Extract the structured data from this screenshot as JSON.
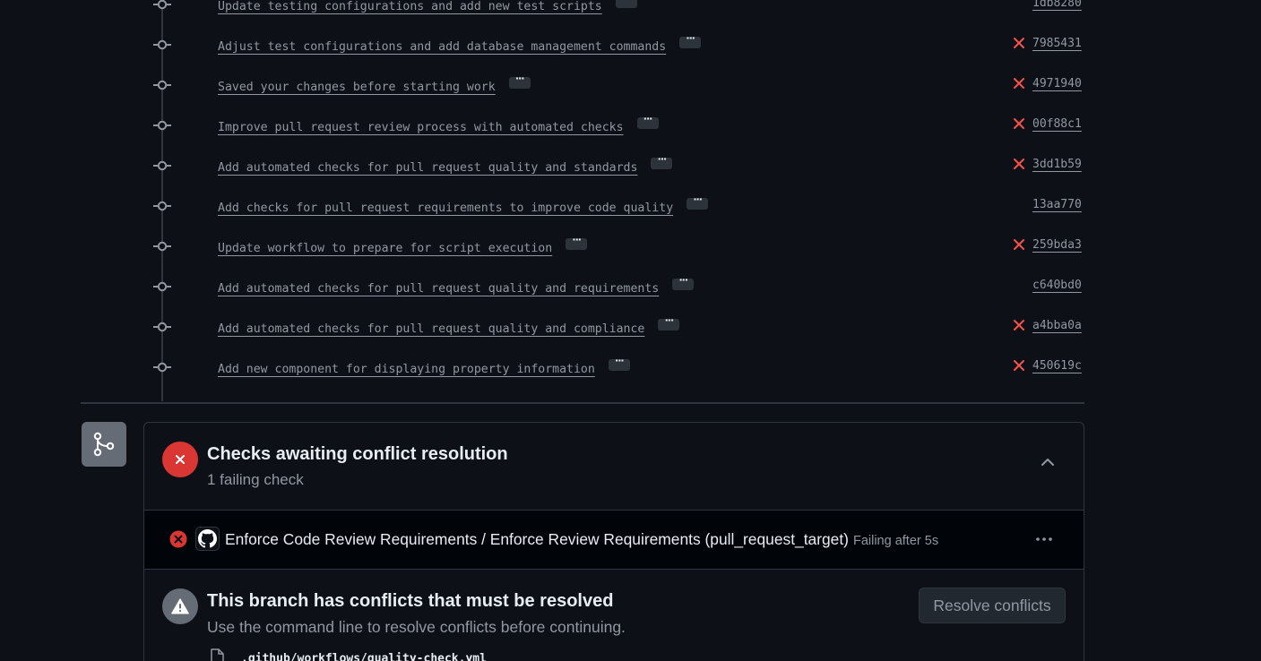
{
  "commits": [
    {
      "message": "Update testing configurations and add new test scripts",
      "sha": "1db8280",
      "failed": false,
      "more_label": "···"
    },
    {
      "message": "Adjust test configurations and add database management commands",
      "sha": "7985431",
      "failed": true,
      "more_label": "···"
    },
    {
      "message": "Saved your changes before starting work",
      "sha": "4971940",
      "failed": true,
      "more_label": "···"
    },
    {
      "message": "Improve pull request review process with automated checks",
      "sha": "00f88c1",
      "failed": true,
      "more_label": "···"
    },
    {
      "message": "Add automated checks for pull request quality and standards",
      "sha": "3dd1b59",
      "failed": true,
      "more_label": "···"
    },
    {
      "message": "Add checks for pull request requirements to improve code quality",
      "sha": "13aa770",
      "failed": false,
      "more_label": "···"
    },
    {
      "message": "Update workflow to prepare for script execution",
      "sha": "259bda3",
      "failed": true,
      "more_label": "···"
    },
    {
      "message": "Add automated checks for pull request quality and requirements",
      "sha": "c640bd0",
      "failed": false,
      "more_label": "···"
    },
    {
      "message": "Add automated checks for pull request quality and compliance",
      "sha": "a4bba0a",
      "failed": true,
      "more_label": "···"
    },
    {
      "message": "Add new component for displaying property information",
      "sha": "450619c",
      "failed": true,
      "more_label": "···"
    }
  ],
  "checks": {
    "title": "Checks awaiting conflict resolution",
    "subtitle": "1 failing check",
    "items": [
      {
        "name": "Enforce Code Review Requirements / Enforce Review Requirements (pull_request_target)",
        "status": "Failing after 5s"
      }
    ]
  },
  "conflicts": {
    "title": "This branch has conflicts that must be resolved",
    "subtitle": "Use the command line to resolve conflicts before continuing.",
    "button_label": "Resolve conflicts",
    "files": [
      ".github/workflows/quality-check.yml"
    ]
  },
  "icons": {
    "commit": "git-commit-icon",
    "fail": "x-icon",
    "merge": "git-merge-icon",
    "collapse": "chevron-up-icon",
    "warning": "alert-icon",
    "app": "github-mark-icon",
    "more": "kebab-horizontal-icon",
    "file": "file-icon"
  },
  "colors": {
    "background": "#0d1117",
    "danger": "#f85149",
    "danger_fill": "#da3633",
    "muted": "#9198a1",
    "border": "#30363d"
  }
}
